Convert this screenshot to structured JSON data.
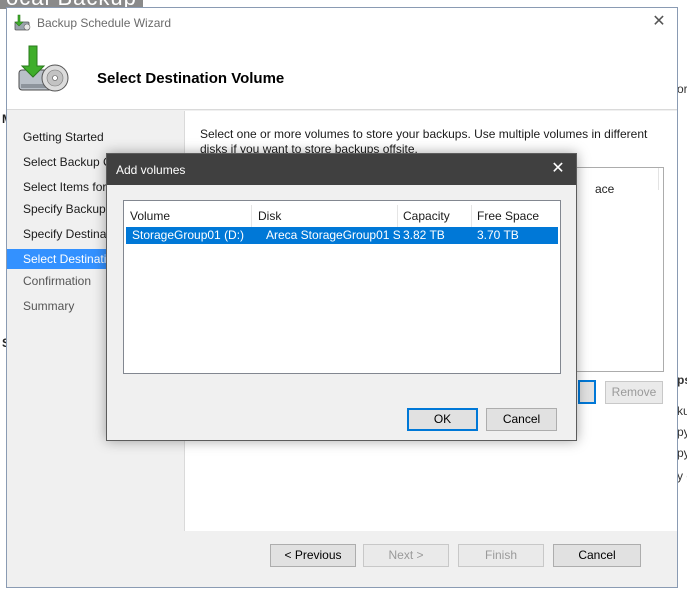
{
  "background": {
    "app_title": "ocal Backup",
    "left_fragments": [
      "M",
      "S"
    ],
    "right_fragments": [
      "or",
      "ps",
      "ku",
      "py",
      "py",
      "y c"
    ]
  },
  "wizard": {
    "title": "Backup Schedule Wizard",
    "close_glyph": "✕",
    "page_title": "Select Destination Volume",
    "nav": [
      {
        "label": "Getting Started",
        "state": "normal"
      },
      {
        "label": "Select Backup Configuration",
        "state": "normal"
      },
      {
        "label": "Select Items for Backup",
        "state": "normal"
      },
      {
        "label": "Specify Backup Time",
        "state": "normal"
      },
      {
        "label": "Specify Destination Type",
        "state": "normal"
      },
      {
        "label": "Select Destination Disk",
        "state": "active"
      },
      {
        "label": "Confirmation",
        "state": "dim"
      },
      {
        "label": "Summary",
        "state": "dim"
      }
    ],
    "description": "Select one or more volumes to store your backups. Use multiple volumes in different disks if you want to store backups offsite.",
    "list_header_fragment": "ace",
    "remove_label": "Remove",
    "previous_label": "< Previous",
    "next_label": "Next >",
    "finish_label": "Finish",
    "cancel_label": "Cancel"
  },
  "dialog": {
    "title": "Add volumes",
    "close_glyph": "✕",
    "columns": [
      "Volume",
      "Disk",
      "Capacity",
      "Free Space"
    ],
    "rows": [
      {
        "volume": "StorageGroup01 (D:)",
        "disk": "Areca StorageGroup01 S...",
        "capacity": "3.82 TB",
        "free_space": "3.70 TB",
        "selected": true
      }
    ],
    "ok_label": "OK",
    "cancel_label": "Cancel"
  },
  "colors": {
    "selection": "#0078d7",
    "nav_active": "#3391ff",
    "dialog_titlebar": "#404040"
  }
}
